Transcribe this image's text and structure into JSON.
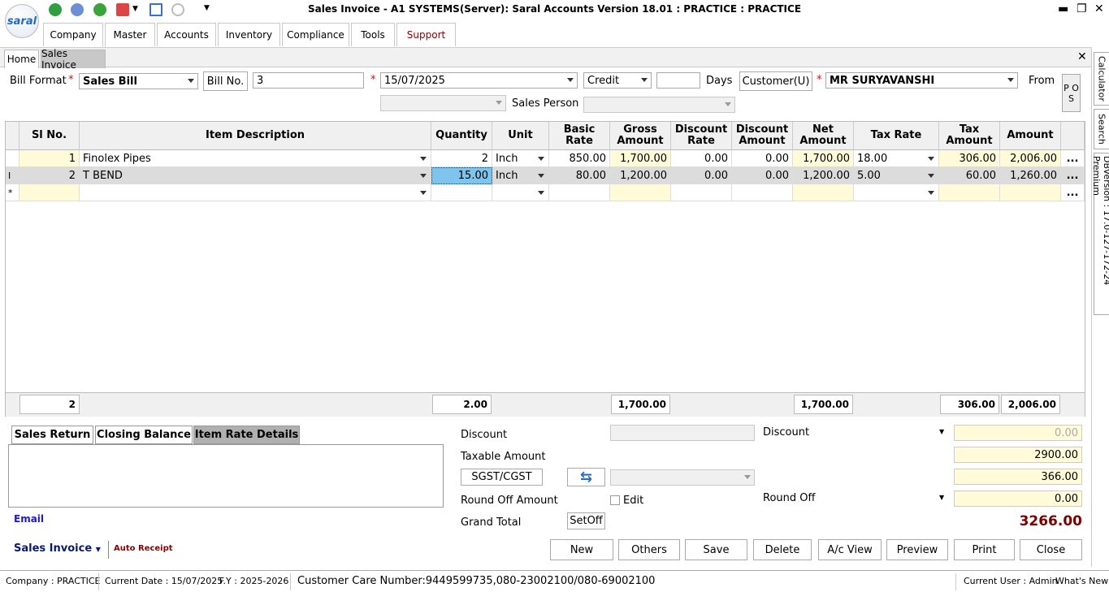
{
  "window": {
    "title": "Sales Invoice - A1 SYSTEMS(Server): Saral Accounts Version 18.01 : PRACTICE : PRACTICE",
    "logo_text": "saral"
  },
  "menu": [
    "Company",
    "Master",
    "Accounts",
    "Inventory",
    "Compliance",
    "Tools",
    "Support"
  ],
  "doc_tabs": [
    "Home",
    "Sales Invoice"
  ],
  "side_tabs": [
    "Calculator",
    "Search",
    "DBVersion : 17.0-127-172-24 Premium"
  ],
  "header": {
    "bill_format_label": "Bill Format",
    "bill_format_value": "Sales Bill",
    "bill_no_label": "Bill No.",
    "bill_no_value": "3",
    "date_value": "15/07/2025",
    "payment_mode": "Credit",
    "days_value": "",
    "days_label": "Days",
    "customer_type": "Customer(U)",
    "customer_name": "MR SURYAVANSHI",
    "from_label": "From",
    "pos_label": "P O S",
    "sales_person_label": "Sales Person"
  },
  "grid": {
    "columns": [
      "Sl No.",
      "Item Description",
      "Quantity",
      "Unit",
      "Basic Rate",
      "Gross Amount",
      "Discount Rate",
      "Discount Amount",
      "Net Amount",
      "Tax Rate",
      "Tax Amount",
      "Amount"
    ],
    "rows": [
      {
        "sl": "1",
        "item": "Finolex Pipes",
        "qty": "2",
        "unit": "Inch",
        "rate": "850.00",
        "gross": "1,700.00",
        "disc_rate": "0.00",
        "disc_amt": "0.00",
        "net": "1,700.00",
        "tax_rate": "18.00",
        "tax_amt": "306.00",
        "amount": "2,006.00"
      },
      {
        "sl": "2",
        "item": "T BEND",
        "qty": "15.00",
        "unit": "Inch",
        "rate": "80.00",
        "gross": "1,200.00",
        "disc_rate": "0.00",
        "disc_amt": "0.00",
        "net": "1,200.00",
        "tax_rate": "5.00",
        "tax_amt": "60.00",
        "amount": "1,260.00"
      }
    ],
    "new_row_marker": "*",
    "row_more": "...",
    "totals": {
      "count": "2",
      "qty": "2.00",
      "gross": "1,700.00",
      "net": "1,700.00",
      "tax": "306.00",
      "amount": "2,006.00"
    }
  },
  "bottom_tabs": [
    "Sales Return",
    "Closing Balance",
    "Item Rate Details"
  ],
  "links": {
    "email": "Email",
    "sales_invoice": "Sales Invoice",
    "auto_receipt": "Auto Receipt"
  },
  "summary": {
    "discount_label": "Discount",
    "discount_right_label": "Discount",
    "discount_value": "0.00",
    "taxable_label": "Taxable Amount",
    "taxable_value": "2900.00",
    "tax_button": "SGST/CGST",
    "tax_value": "366.00",
    "roundoff_label": "Round Off Amount",
    "edit_label": "Edit",
    "roundoff_right_label": "Round Off",
    "roundoff_value": "0.00",
    "grand_total_label": "Grand Total",
    "setoff_button": "SetOff",
    "grand_total_value": "3266.00"
  },
  "actions": [
    "New",
    "Others",
    "Save",
    "Delete",
    "A/c View",
    "Preview",
    "Print",
    "Close"
  ],
  "status": {
    "company": "Company : PRACTICE",
    "current_date": "Current Date : 15/07/2025",
    "fy": "F.Y : 2025-2026",
    "customer_care": "Customer Care Number:9449599735,080-23002100/080-69002100",
    "current_user": "Current User : Admin",
    "whats_new": "What's New"
  },
  "colors": {
    "grand_total": "#7a0000",
    "email_link": "#1a1acc",
    "sales_invoice_link": "#0a1a6e",
    "auto_receipt": "#8b0000",
    "support_tab": "#8b0000"
  }
}
